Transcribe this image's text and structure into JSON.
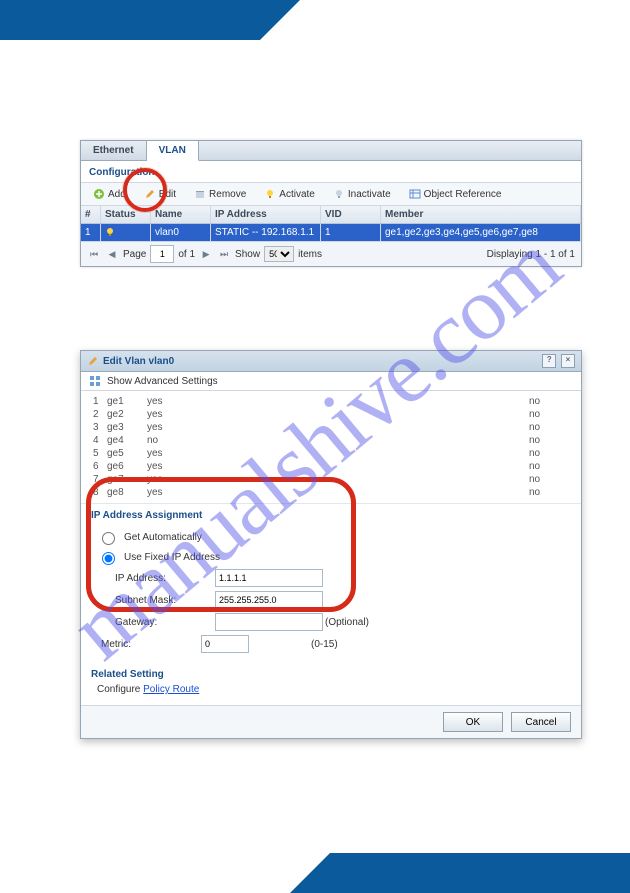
{
  "tabs": {
    "ethernet": "Ethernet",
    "vlan": "VLAN"
  },
  "config_title": "Configuration",
  "toolbar": {
    "add": "Add",
    "edit": "Edit",
    "remove": "Remove",
    "activate": "Activate",
    "inactivate": "Inactivate",
    "objref": "Object Reference"
  },
  "cols": {
    "num": "#",
    "status": "Status",
    "name": "Name",
    "ip": "IP Address",
    "vid": "VID",
    "member": "Member"
  },
  "row1": {
    "num": "1",
    "name": "vlan0",
    "ip": "STATIC -- 192.168.1.1",
    "vid": "1",
    "member": "ge1,ge2,ge3,ge4,ge5,ge6,ge7,ge8"
  },
  "pager": {
    "page_lbl": "Page",
    "page": "1",
    "of_lbl": "of 1",
    "show_lbl": "Show",
    "show": "50",
    "items": "items",
    "summary": "Displaying 1 - 1 of 1"
  },
  "dialog": {
    "title": "Edit Vlan vlan0",
    "advanced": "Show Advanced Settings",
    "ports": [
      {
        "n": "1",
        "id": "ge1",
        "ena": "yes",
        "j": "no"
      },
      {
        "n": "2",
        "id": "ge2",
        "ena": "yes",
        "j": "no"
      },
      {
        "n": "3",
        "id": "ge3",
        "ena": "yes",
        "j": "no"
      },
      {
        "n": "4",
        "id": "ge4",
        "ena": "no",
        "j": "no"
      },
      {
        "n": "5",
        "id": "ge5",
        "ena": "yes",
        "j": "no"
      },
      {
        "n": "6",
        "id": "ge6",
        "ena": "yes",
        "j": "no"
      },
      {
        "n": "7",
        "id": "ge7",
        "ena": "yes",
        "j": "no"
      },
      {
        "n": "8",
        "id": "ge8",
        "ena": "yes",
        "j": "no"
      }
    ],
    "ip_title": "IP Address Assignment",
    "get_auto": "Get Automatically",
    "use_fixed": "Use Fixed IP Address",
    "ip_lbl": "IP Address:",
    "ip_val": "1.1.1.1",
    "mask_lbl": "Subnet Mask:",
    "mask_val": "255.255.255.0",
    "gw_lbl": "Gateway:",
    "gw_val": "",
    "gw_opt": "(Optional)",
    "metric_lbl": "Metric:",
    "metric_val": "0",
    "metric_range": "(0-15)",
    "related_title": "Related Setting",
    "related_cfg": "Configure ",
    "related_link": "Policy Route",
    "ok": "OK",
    "cancel": "Cancel"
  },
  "watermark": "manualshive.com"
}
